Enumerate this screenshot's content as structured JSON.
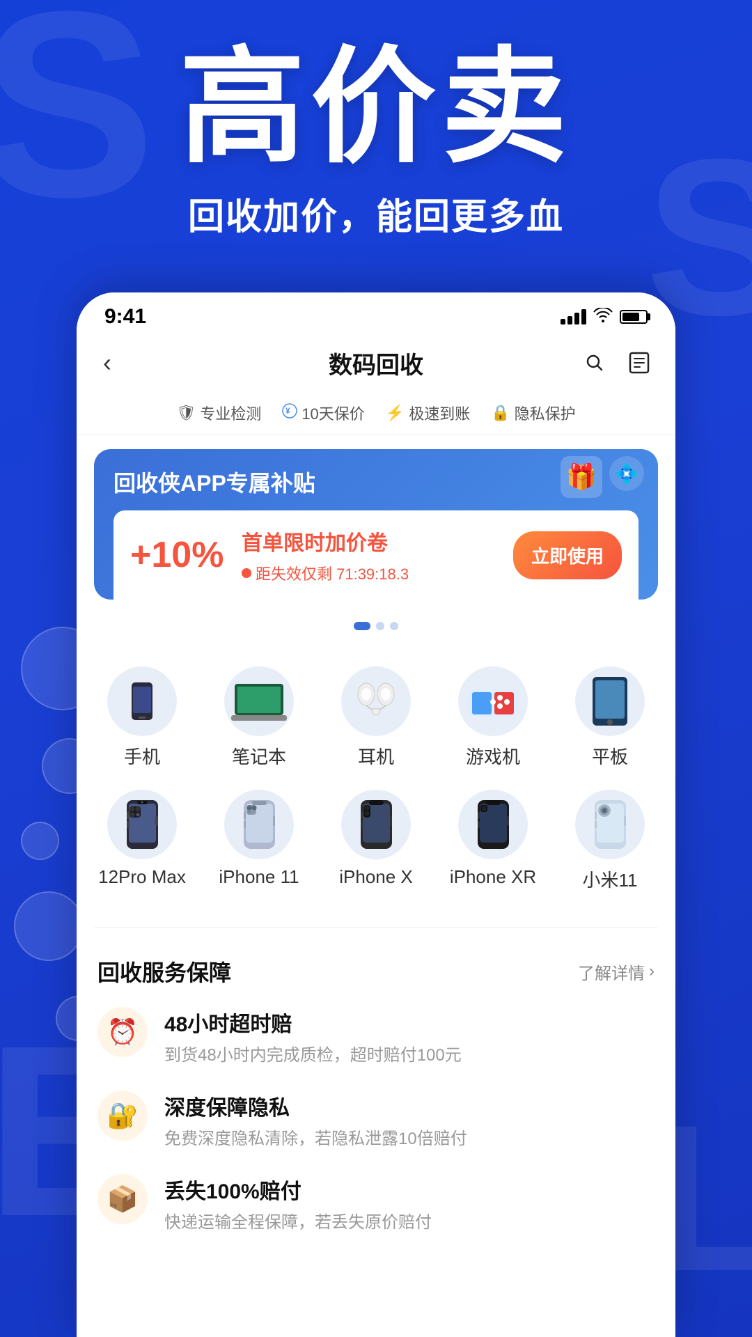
{
  "background": {
    "letters": [
      "S",
      "S",
      "E",
      "LL"
    ]
  },
  "hero": {
    "title": "高价卖",
    "subtitle": "回收加价，能回更多血"
  },
  "statusBar": {
    "time": "9:41"
  },
  "navbar": {
    "back": "‹",
    "title": "数码回收",
    "searchLabel": "search",
    "notesLabel": "notes"
  },
  "featureBadges": [
    {
      "icon": "🛡",
      "label": "专业检测"
    },
    {
      "icon": "¥",
      "label": "10天保价"
    },
    {
      "icon": "⚡",
      "label": "极速到账"
    },
    {
      "icon": "🔒",
      "label": "隐私保护"
    }
  ],
  "promoBanner": {
    "title": "回收侠APP专属补贴",
    "percent": "+10%",
    "couponTitle": "首单限时加价卷",
    "countdown": "距失效仅剩 71:39:18.3",
    "btnLabel": "立即使用"
  },
  "categories": {
    "row1": [
      {
        "label": "手机"
      },
      {
        "label": "笔记本"
      },
      {
        "label": "耳机"
      },
      {
        "label": "游戏机"
      },
      {
        "label": "平板"
      }
    ],
    "row2": [
      {
        "label": "12Pro Max"
      },
      {
        "label": "iPhone 11"
      },
      {
        "label": "iPhone X"
      },
      {
        "label": "iPhone XR"
      },
      {
        "label": "小米11"
      }
    ]
  },
  "serviceSection": {
    "title": "回收服务保障",
    "moreLabel": "了解详情",
    "items": [
      {
        "icon": "⏰",
        "title": "48小时超时赔",
        "desc": "到货48小时内完成质检，超时赔付100元"
      },
      {
        "icon": "🔐",
        "title": "深度保障隐私",
        "desc": "免费深度隐私清除，若隐私泄露10倍赔付"
      },
      {
        "icon": "📦",
        "title": "丢失100%赔付",
        "desc": "快递运输全程保障，若丢失原价赔付"
      }
    ]
  }
}
